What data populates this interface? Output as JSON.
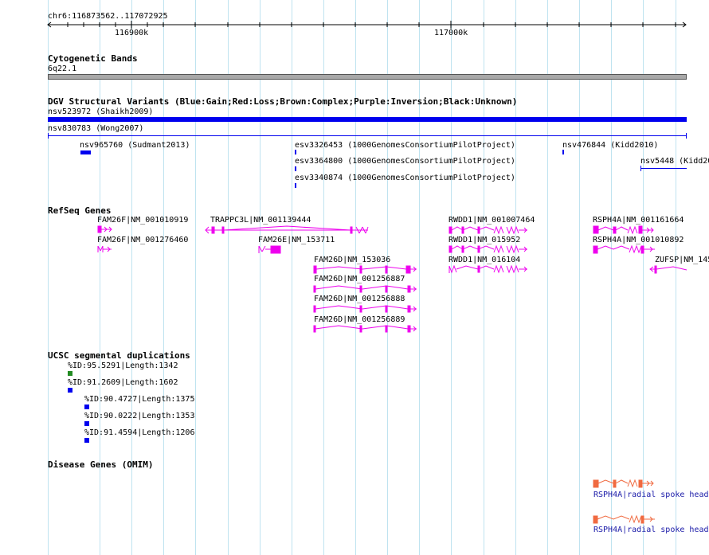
{
  "ruler": {
    "location": "chr6:116873562..117072925",
    "ticks": [
      "116900k",
      "117000k"
    ]
  },
  "cytoband": {
    "title": "Cytogenetic Bands",
    "band": "6q22.1"
  },
  "dgv": {
    "title": "DGV Structural Variants (Blue:Gain;Red:Loss;Brown:Complex;Purple:Inversion;Black:Unknown)",
    "items": [
      "nsv523972 (Shaikh2009)",
      "nsv830783 (Wong2007)",
      "nsv965760 (Sudmant2013)",
      "esv3326453 (1000GenomesConsortiumPilotProject)",
      "esv3364800 (1000GenomesConsortiumPilotProject)",
      "esv3340874 (1000GenomesConsortiumPilotProject)",
      "nsv476844 (Kidd2010)",
      "nsv5448 (Kidd20"
    ],
    "colors": {
      "gain": "#0000ee"
    }
  },
  "refseq": {
    "title": "RefSeq Genes",
    "genes": [
      "FAM26F|NM_001010919",
      "FAM26F|NM_001276460",
      "TRAPPC3L|NM_001139444",
      "FAM26E|NM_153711",
      "FAM26D|NM_153036",
      "FAM26D|NM_001256887",
      "FAM26D|NM_001256888",
      "FAM26D|NM_001256889",
      "RWDD1|NM_001007464",
      "RWDD1|NM_015952",
      "RWDD1|NM_016104",
      "RSPH4A|NM_001161664",
      "RSPH4A|NM_001010892",
      "ZUFSP|NM_145"
    ],
    "color": "#ee00ee"
  },
  "segdup": {
    "title": "UCSC segmental duplications",
    "items": [
      "%ID:95.5291|Length:1342",
      "%ID:91.2609|Length:1602",
      "%ID:90.4727|Length:1375",
      "%ID:90.0222|Length:1353",
      "%ID:91.4594|Length:1206"
    ],
    "colors": {
      "green": "#228b22",
      "blue": "#0000ee"
    }
  },
  "omim": {
    "title": "Disease Genes (OMIM)",
    "items": [
      "RSPH4A|radial spoke head",
      "RSPH4A|radial spoke head"
    ],
    "color": "#f06a40"
  }
}
